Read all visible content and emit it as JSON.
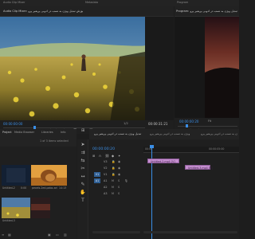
{
  "menu": {
    "items": [
      "Audio Clip Mixer",
      "Metadata",
      "Program"
    ],
    "source_tab_label": "Audio Clip Mixer: آموزش تبدیل ویژن به نسب در ادوبی پریمیر پرو",
    "program_label": "Program: آموزش تبدیل ویژن به نسب در ادوبی پریمیر پرو"
  },
  "source": {
    "timecode_left": "00:00:00:00",
    "timecode_right": "00:00:31:21",
    "zoom": "1/2"
  },
  "program": {
    "timecode": "00:00:00:20",
    "zoom": "Fit",
    "fraction": "1/2"
  },
  "project": {
    "tabs": [
      "Project",
      "Media Browser",
      "Libraries",
      "Info"
    ],
    "items_label": "1 of 3 items selected",
    "clips": [
      {
        "name": "Untitled-2",
        "duration": "0:00"
      },
      {
        "name": "pexels-2ed-pabo-ari",
        "duration": "14:13"
      },
      {
        "name": "Untitled-3",
        "duration": ""
      },
      {
        "name": "",
        "duration": ""
      }
    ]
  },
  "timeline": {
    "sequence_title": "آموزش تبدیل ویژن به نسب در ادوبی پریمیر پرو",
    "timecode": "00:00:00:20",
    "ruler_start": "00:00",
    "ruler_end": "00:00:05:00",
    "tracks": [
      "V3",
      "V2",
      "V1",
      "A1",
      "A2",
      "A3"
    ],
    "clips": [
      {
        "label": "Untitled-2.mp4 [V]"
      },
      {
        "label": "Untitled-3.mp4 [V]"
      }
    ]
  },
  "colors": {
    "accent": "#3a8ee6",
    "clip": "#c58fd0",
    "playhead": "#3a8ee6"
  }
}
